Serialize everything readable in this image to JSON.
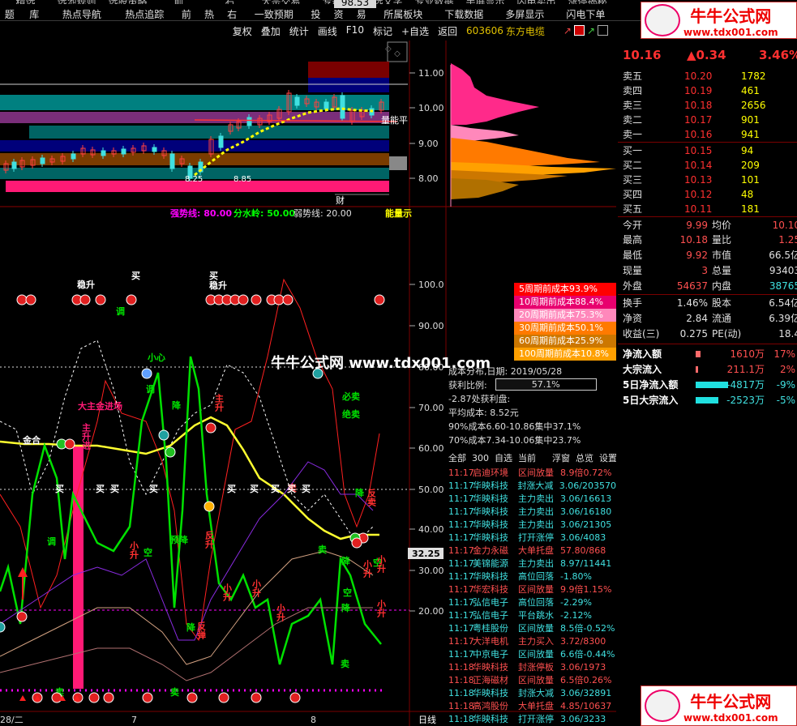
{
  "menu": {
    "row1": [
      "精选",
      "选池规则",
      "选股策略",
      "前",
      "右",
      "大宗交易",
      "专题",
      "精选文字",
      "专业数据",
      "半屏显示",
      "闪电卖出",
      "涨停揭秘"
    ],
    "row2": [
      "题",
      "库",
      "热点导航",
      "热点追踪",
      "前",
      "热",
      "右",
      "一致预期",
      "投",
      "资",
      "易",
      "所属板块",
      "下载数据",
      "多屏显示",
      "闪电下单"
    ],
    "badge": "98.53"
  },
  "toolbar": {
    "items": [
      "复权",
      "叠加",
      "统计",
      "画线",
      "F10",
      "标记",
      "+自选",
      "返回"
    ],
    "stock_code": "603606",
    "stock_name": "东方电缆"
  },
  "price_axis": [
    "11.00",
    "10.00",
    "9.00",
    "8.00"
  ],
  "kline_labels": {
    "left_low": "8.25",
    "mid": "8.85",
    "right_flag": "量能平",
    "cai": "财"
  },
  "indicator": {
    "strong": "强势线: 80.00",
    "water": "分水岭: 50.00",
    "weak": "弱势线: 20.00",
    "energy": "能量示",
    "axis": [
      "100.0",
      "90.00",
      "80.00",
      "70.00",
      "60.00",
      "50.00",
      "40.00",
      "30.00",
      "20.00"
    ],
    "cursor_value": "32.25",
    "labels": {
      "wen1": "稳升",
      "mai1": "买",
      "mai2": "买",
      "wen2": "稳升",
      "tiao1": "调",
      "tiao2": "调",
      "tiao3": "调",
      "xiaoxin": "小心",
      "jiang1": "降",
      "jiang2": "降",
      "jiang3": "降",
      "jiang4": "降",
      "jiang5": "降",
      "bixmai": "必卖",
      "juemai": "绝卖",
      "dazhu": "大主金进场",
      "zhusheng": "主升进",
      "zhusheng2": "主升",
      "jinhe": "金合",
      "yujiang": "预降",
      "kong1": "空",
      "kong2": "空",
      "kong3": "空",
      "xiaosheng": "小升",
      "mai_row": "买",
      "fanmai": "反卖",
      "mai_r": "卖",
      "fansheng": "反升",
      "xiaoshengL": "小升",
      "xiaosheng3": "小升",
      "xiaosheng4": "小升",
      "xiaosheng5": "小升",
      "xiaoshengR": "小升",
      "mai_b": "卖",
      "mai_c": "卖",
      "fanshengm": "反弹"
    },
    "date_labels": [
      "28/二",
      "7",
      "8"
    ],
    "period": "日线"
  },
  "watermark": "牛牛公式网 www.tdx001.com",
  "cost_table": [
    {
      "label": "5周期前成本93.9%",
      "color": "#ff0000"
    },
    {
      "label": "10周期前成本88.4%",
      "color": "#e8006e"
    },
    {
      "label": "20周期前成本75.3%",
      "color": "#ff88bb"
    },
    {
      "label": "30周期前成本50.1%",
      "color": "#ff7a00"
    },
    {
      "label": "60周期前成本25.9%",
      "color": "#cc7700"
    },
    {
      "label": "100周期前成本10.8%",
      "color": "#ffa000"
    }
  ],
  "cost_info": {
    "date": "成本分布,日期: 2019/05/28",
    "ratio_label": "获利比例:",
    "ratio_value": "57.1%",
    "profit": "-2.87处获利盘:",
    "avg": "平均成本: 8.52元",
    "c90": "90%成本6.60-10.86集中37.1%",
    "c70": "70%成本7.34-10.06集中23.7%"
  },
  "news_tabs": [
    "全部",
    "300",
    "自选",
    "当前",
    "浮窗",
    "总览",
    "设置"
  ],
  "news": [
    {
      "t": "11:17",
      "n": "启迪环境",
      "e": "区间放量",
      "v": "8.9倍0.72%",
      "c": "#ff5050"
    },
    {
      "t": "11:17",
      "n": "华映科技",
      "e": "封涨大减",
      "v": "3.06/203570",
      "c": "#40e0e0"
    },
    {
      "t": "11:17",
      "n": "华映科技",
      "e": "主力卖出",
      "v": "3.06/16613",
      "c": "#40e0e0"
    },
    {
      "t": "11:17",
      "n": "华映科技",
      "e": "主力卖出",
      "v": "3.06/16180",
      "c": "#40e0e0"
    },
    {
      "t": "11:17",
      "n": "华映科技",
      "e": "主力卖出",
      "v": "3.06/21305",
      "c": "#40e0e0"
    },
    {
      "t": "11:17",
      "n": "华映科技",
      "e": "打开涨停",
      "v": "3.06/4083",
      "c": "#40e0e0"
    },
    {
      "t": "11:17",
      "n": "金力永磁",
      "e": "大单托盘",
      "v": "57.80/868",
      "c": "#ff5050"
    },
    {
      "t": "11:17",
      "n": "美锦能源",
      "e": "主力卖出",
      "v": "8.97/11441",
      "c": "#40e0e0"
    },
    {
      "t": "11:17",
      "n": "华映科技",
      "e": "高位回落",
      "v": "-1.80%",
      "c": "#40e0e0"
    },
    {
      "t": "11:17",
      "n": "华宏科技",
      "e": "区间放量",
      "v": "9.9倍1.15%",
      "c": "#ff5050"
    },
    {
      "t": "11:17",
      "n": "弘信电子",
      "e": "高位回落",
      "v": "-2.29%",
      "c": "#40e0e0"
    },
    {
      "t": "11:17",
      "n": "弘信电子",
      "e": "平台跳水",
      "v": "-2.12%",
      "c": "#40e0e0"
    },
    {
      "t": "11:17",
      "n": "粤桂股份",
      "e": "区间放量",
      "v": "8.5倍-0.52%",
      "c": "#40e0e0"
    },
    {
      "t": "11:17",
      "n": "大洋电机",
      "e": "主力买入",
      "v": "3.72/8300",
      "c": "#ff5050"
    },
    {
      "t": "11:17",
      "n": "中京电子",
      "e": "区间放量",
      "v": "6.6倍-0.44%",
      "c": "#40e0e0"
    },
    {
      "t": "11:18",
      "n": "华映科技",
      "e": "封涨停板",
      "v": "3.06/1973",
      "c": "#ff5050"
    },
    {
      "t": "11:18",
      "n": "正海磁材",
      "e": "区间放量",
      "v": "6.5倍0.26%",
      "c": "#ff5050"
    },
    {
      "t": "11:18",
      "n": "华映科技",
      "e": "封涨大减",
      "v": "3.06/32891",
      "c": "#40e0e0"
    },
    {
      "t": "11:18",
      "n": "高鸿股份",
      "e": "大单托盘",
      "v": "4.85/10637",
      "c": "#ff5050"
    },
    {
      "t": "11:18",
      "n": "华映科技",
      "e": "打开涨停",
      "v": "3.06/3233",
      "c": "#40e0e0"
    }
  ],
  "quote": {
    "price": "10.16",
    "change": "▲0.34",
    "pct": "3.46%",
    "sells": [
      {
        "l": "卖五",
        "p": "10.20",
        "v": "1782"
      },
      {
        "l": "卖四",
        "p": "10.19",
        "v": "461"
      },
      {
        "l": "卖三",
        "p": "10.18",
        "v": "2656"
      },
      {
        "l": "卖二",
        "p": "10.17",
        "v": "901"
      },
      {
        "l": "卖一",
        "p": "10.16",
        "v": "941"
      }
    ],
    "buys": [
      {
        "l": "买一",
        "p": "10.15",
        "v": "94"
      },
      {
        "l": "买二",
        "p": "10.14",
        "v": "209"
      },
      {
        "l": "买三",
        "p": "10.13",
        "v": "101"
      },
      {
        "l": "买四",
        "p": "10.12",
        "v": "48"
      },
      {
        "l": "买五",
        "p": "10.11",
        "v": "181"
      }
    ],
    "stats": [
      {
        "a": "今开",
        "av": "9.99",
        "ac": "#ff5050",
        "b": "均价",
        "bv": "10.10",
        "bc": "#ff5050"
      },
      {
        "a": "最高",
        "av": "10.18",
        "ac": "#ff5050",
        "b": "量比",
        "bv": "1.25",
        "bc": "#ff5050"
      },
      {
        "a": "最低",
        "av": "9.92",
        "ac": "#ff5050",
        "b": "市值",
        "bv": "66.5亿",
        "bc": "#e0e0e0"
      },
      {
        "a": "现量",
        "av": "3",
        "ac": "#ff5050",
        "b": "总量",
        "bv": "93403",
        "bc": "#e0e0e0"
      },
      {
        "a": "外盘",
        "av": "54637",
        "ac": "#ff5050",
        "b": "内盘",
        "bv": "38765",
        "bc": "#40e0e0"
      },
      {
        "a": "换手",
        "av": "1.46%",
        "ac": "#e0e0e0",
        "b": "股本",
        "bv": "6.54亿",
        "bc": "#e0e0e0"
      },
      {
        "a": "净资",
        "av": "2.84",
        "ac": "#e0e0e0",
        "b": "流通",
        "bv": "6.39亿",
        "bc": "#e0e0e0"
      },
      {
        "a": "收益(三)",
        "av": "0.275",
        "ac": "#e0e0e0",
        "b": "PE(动)",
        "bv": "18.4",
        "bc": "#e0e0e0"
      }
    ],
    "flows": [
      {
        "l": "净流入额",
        "v": "1610万",
        "p": "17%",
        "c": "#ff5050"
      },
      {
        "l": "大宗流入",
        "v": "211.1万",
        "p": "2%",
        "c": "#ff5050"
      },
      {
        "l": "5日净流入额",
        "v": "-4817万",
        "p": "-9%",
        "c": "#40e0e0"
      },
      {
        "l": "5日大宗流入",
        "v": "-2523万",
        "p": "-5%",
        "c": "#40e0e0"
      }
    ]
  },
  "logo": {
    "cn": "牛牛公式网",
    "url": "www.tdx001.com"
  }
}
